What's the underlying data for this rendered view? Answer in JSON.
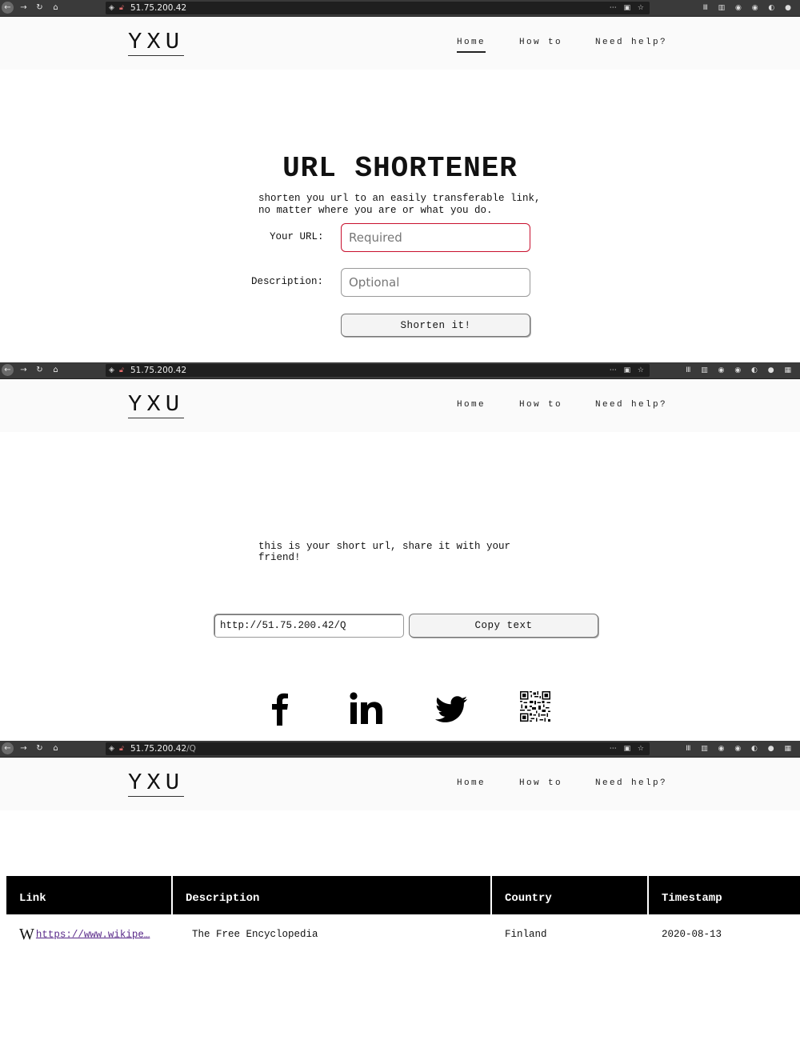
{
  "browser": {
    "url1": "51.75.200.42",
    "url2": "51.75.200.42",
    "url3_host": "51.75.200.42",
    "url3_path": "/Q"
  },
  "site": {
    "logo": "YXU",
    "nav": [
      "Home",
      "How to",
      "Need help?"
    ]
  },
  "shortener": {
    "title": "URL SHORTENER",
    "subtitle": "shorten you url to an easily transferable link,\nno matter where you are or what you do.",
    "url_label": "Your URL:",
    "url_placeholder": "Required",
    "desc_label": "Description:",
    "desc_placeholder": "Optional",
    "submit_label": "Shorten it!"
  },
  "result": {
    "message": "this is your short url, share it with your\nfriend!",
    "short_url": "http://51.75.200.42/Q",
    "copy_label": "Copy text",
    "social": [
      "facebook-icon",
      "linkedin-icon",
      "twitter-icon",
      "qr-code-icon"
    ]
  },
  "table": {
    "headers": [
      "Link",
      "Description",
      "Country",
      "Timestamp"
    ],
    "rows": [
      {
        "link": "https://www.wikipe…",
        "description": "The Free Encyclopedia",
        "country": "Finland",
        "timestamp": "2020-08-13"
      }
    ]
  },
  "colors": {
    "required_border": "#c8102e",
    "toolbar": "#3a3a3a",
    "header_bg": "#fafafa"
  }
}
